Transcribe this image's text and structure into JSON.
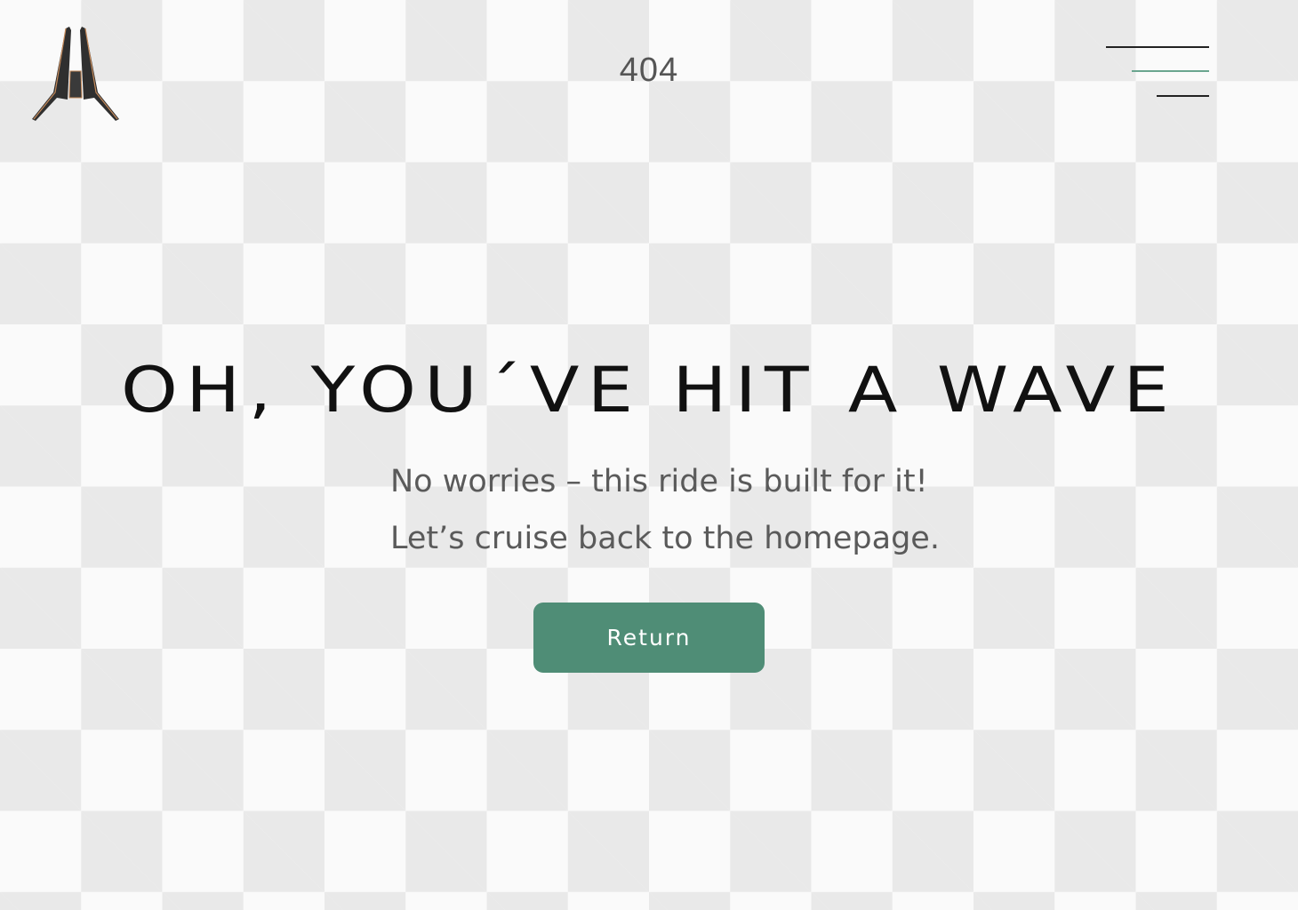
{
  "header": {
    "error_code": "404"
  },
  "main": {
    "headline": "OH, YOU´VE HIT A WAVE",
    "message_line1": "No worries – this ride is built for it!",
    "message_line2": "Let’s cruise back to the homepage.",
    "return_label": "Return"
  },
  "colors": {
    "accent": "#4f8d76",
    "menu_accent": "#6aa58f",
    "text_dark": "#111111",
    "text_muted": "#5a5a5a",
    "checker_light": "#fafafa",
    "checker_dark": "#e9e9e9"
  },
  "icons": {
    "logo": "brand-logo-icon",
    "menu": "hamburger-menu-icon"
  }
}
